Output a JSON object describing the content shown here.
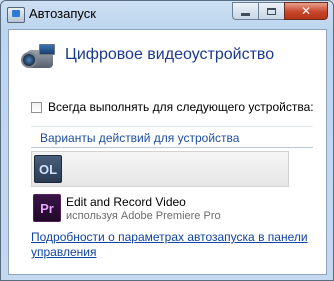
{
  "window": {
    "title": "Автозапуск",
    "close_glyph": "✕"
  },
  "device": {
    "title": "Цифровое видеоустройство",
    "icon": "camcorder-icon"
  },
  "always_checkbox": {
    "label": "Всегда выполнять для следующего устройства:",
    "checked": false
  },
  "section": {
    "title": "Варианты действий для устройства"
  },
  "options": [
    {
      "icon_text": "OL",
      "icon_name": "ol-app-icon",
      "label": "",
      "sublabel": ""
    },
    {
      "icon_text": "Pr",
      "icon_name": "premiere-pro-icon",
      "label": "Edit and Record Video",
      "sublabel": "используя Adobe Premiere Pro"
    }
  ],
  "footer": {
    "link_text": "Подробности о параметрах автозапуска в панели управления"
  },
  "colors": {
    "link": "#0f44a3",
    "heading": "#1b3a8c",
    "close_button": "#c7452a"
  }
}
